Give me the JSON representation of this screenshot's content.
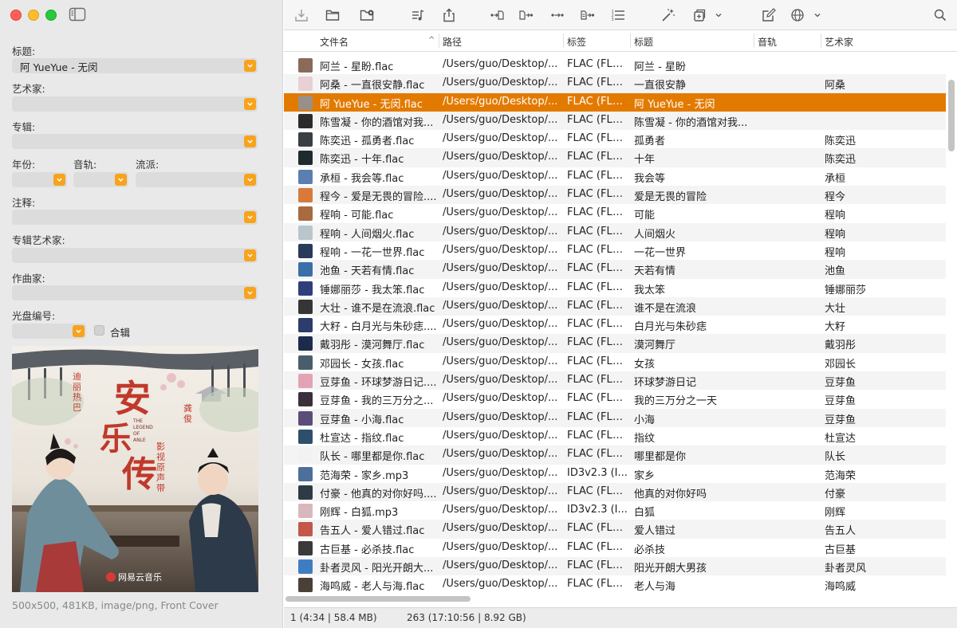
{
  "sidebar": {
    "fields": {
      "title_label": "标题:",
      "title_value": "阿 YueYue - 无闵",
      "artist_label": "艺术家:",
      "artist_value": "",
      "album_label": "专辑:",
      "album_value": "",
      "year_label": "年份:",
      "track_label": "音轨:",
      "genre_label": "流派:",
      "comment_label": "注释:",
      "album_artist_label": "专辑艺术家:",
      "composer_label": "作曲家:",
      "disc_label": "光盘编号:",
      "compilation_label": "合辑"
    },
    "cover_info": "500x500, 481KB, image/png, Front Cover",
    "cover_text": {
      "big_title": "安乐传",
      "en_title": "THE LEGEND OF ANLE",
      "left_vertical": "迪丽热巴",
      "right_vertical": "龚俊",
      "subtitle": "影视原声带",
      "brand": "网易云音乐"
    }
  },
  "toolbar": {
    "icons": [
      "tray-download-icon",
      "folder-icon",
      "folder-gear-icon",
      "music-list-icon",
      "share-icon",
      "tag-to-file-icon",
      "file-to-tag-icon",
      "tag-to-tag-icon",
      "text-file-to-tag-icon",
      "numbered-list-icon",
      "magic-wand-icon",
      "copy-icon",
      "chevron-down-icon",
      "edit-icon",
      "globe-icon",
      "chevron-down-icon",
      "search-icon"
    ]
  },
  "table": {
    "columns": [
      "文件名",
      "路径",
      "标签",
      "标题",
      "音轨",
      "艺术家"
    ],
    "rows": [
      {
        "file": "阿兰 - 星盼.flac",
        "path": "/Users/guo/Desktop/...",
        "tag": "FLAC (FLA...",
        "title": "阿兰 - 星盼",
        "artist": "",
        "thumb": "#8a6a5a"
      },
      {
        "file": "阿桑 - 一直很安静.flac",
        "path": "/Users/guo/Desktop/...",
        "tag": "FLAC (FLA...",
        "title": "一直很安静",
        "artist": "阿桑",
        "thumb": "#e8d0d6"
      },
      {
        "file": "阿 YueYue - 无闵.flac",
        "path": "/Users/guo/Desktop/...",
        "tag": "FLAC (FLA...",
        "title": "阿 YueYue - 无闵",
        "artist": "",
        "thumb": "#9a8f86"
      },
      {
        "file": "陈雪凝 - 你的酒馆对我...",
        "path": "/Users/guo/Desktop/...",
        "tag": "FLAC (FLA...",
        "title": "陈雪凝 - 你的酒馆对我...",
        "artist": "",
        "thumb": "#2d2a2a"
      },
      {
        "file": "陈奕迅 - 孤勇者.flac",
        "path": "/Users/guo/Desktop/...",
        "tag": "FLAC (FLA...",
        "title": "孤勇者",
        "artist": "陈奕迅",
        "thumb": "#3a3f44"
      },
      {
        "file": "陈奕迅 - 十年.flac",
        "path": "/Users/guo/Desktop/...",
        "tag": "FLAC (FLA...",
        "title": "十年",
        "artist": "陈奕迅",
        "thumb": "#1f2a2f"
      },
      {
        "file": "承桓 - 我会等.flac",
        "path": "/Users/guo/Desktop/...",
        "tag": "FLAC (FLA...",
        "title": "我会等",
        "artist": "承桓",
        "thumb": "#5b7fb0"
      },
      {
        "file": "程今 - 爱是无畏的冒险....",
        "path": "/Users/guo/Desktop/...",
        "tag": "FLAC (FLA...",
        "title": "爱是无畏的冒险",
        "artist": "程今",
        "thumb": "#d87a3a"
      },
      {
        "file": "程响 - 可能.flac",
        "path": "/Users/guo/Desktop/...",
        "tag": "FLAC (FLA...",
        "title": "可能",
        "artist": "程响",
        "thumb": "#a86a3e"
      },
      {
        "file": "程响 - 人间烟火.flac",
        "path": "/Users/guo/Desktop/...",
        "tag": "FLAC (FLA...",
        "title": "人间烟火",
        "artist": "程响",
        "thumb": "#b9c6cc"
      },
      {
        "file": "程响 - 一花一世界.flac",
        "path": "/Users/guo/Desktop/...",
        "tag": "FLAC (FLA...",
        "title": "一花一世界",
        "artist": "程响",
        "thumb": "#2a3a5a"
      },
      {
        "file": "池鱼 - 天若有情.flac",
        "path": "/Users/guo/Desktop/...",
        "tag": "FLAC (FLA...",
        "title": "天若有情",
        "artist": "池鱼",
        "thumb": "#3b6fa8"
      },
      {
        "file": "锤娜丽莎 - 我太笨.flac",
        "path": "/Users/guo/Desktop/...",
        "tag": "FLAC (FLA...",
        "title": "我太笨",
        "artist": "锤娜丽莎",
        "thumb": "#2f3e7a"
      },
      {
        "file": "大壮 - 谁不是在流浪.flac",
        "path": "/Users/guo/Desktop/...",
        "tag": "FLAC (FLA...",
        "title": "谁不是在流浪",
        "artist": "大壮",
        "thumb": "#353535"
      },
      {
        "file": "大籽 - 白月光与朱砂痣....",
        "path": "/Users/guo/Desktop/...",
        "tag": "FLAC (FLA...",
        "title": "白月光与朱砂痣",
        "artist": "大籽",
        "thumb": "#2c3c6c"
      },
      {
        "file": "戴羽彤 - 漠河舞厅.flac",
        "path": "/Users/guo/Desktop/...",
        "tag": "FLAC (FLA...",
        "title": "漠河舞厅",
        "artist": "戴羽彤",
        "thumb": "#1d2b4a"
      },
      {
        "file": "邓园长 - 女孩.flac",
        "path": "/Users/guo/Desktop/...",
        "tag": "FLAC (FLA...",
        "title": "女孩",
        "artist": "邓园长",
        "thumb": "#4a5d6b"
      },
      {
        "file": "豆芽鱼 - 环球梦游日记....",
        "path": "/Users/guo/Desktop/...",
        "tag": "FLAC (FLA...",
        "title": "环球梦游日记",
        "artist": "豆芽鱼",
        "thumb": "#e3a3b6"
      },
      {
        "file": "豆芽鱼 - 我的三万分之...",
        "path": "/Users/guo/Desktop/...",
        "tag": "FLAC (FLA...",
        "title": "我的三万分之一天",
        "artist": "豆芽鱼",
        "thumb": "#3a2f3a"
      },
      {
        "file": "豆芽鱼 - 小海.flac",
        "path": "/Users/guo/Desktop/...",
        "tag": "FLAC (FLA...",
        "title": "小海",
        "artist": "豆芽鱼",
        "thumb": "#5a4d7a"
      },
      {
        "file": "杜宣达 - 指纹.flac",
        "path": "/Users/guo/Desktop/...",
        "tag": "FLAC (FLA...",
        "title": "指纹",
        "artist": "杜宣达",
        "thumb": "#2d4f6c"
      },
      {
        "file": "队长 - 哪里都是你.flac",
        "path": "/Users/guo/Desktop/...",
        "tag": "FLAC (FLA...",
        "title": "哪里都是你",
        "artist": "队长",
        "thumb": "#f2f2f2"
      },
      {
        "file": "范海荣 - 家乡.mp3",
        "path": "/Users/guo/Desktop/...",
        "tag": "ID3v2.3 (I...",
        "title": "家乡",
        "artist": "范海荣",
        "thumb": "#4e6f9a"
      },
      {
        "file": "付豪 - 他真的对你好吗....",
        "path": "/Users/guo/Desktop/...",
        "tag": "FLAC (FLA...",
        "title": "他真的对你好吗",
        "artist": "付豪",
        "thumb": "#2e3b45"
      },
      {
        "file": "刚辉 - 白狐.mp3",
        "path": "/Users/guo/Desktop/...",
        "tag": "ID3v2.3 (I...",
        "title": "白狐",
        "artist": "刚辉",
        "thumb": "#d9b7bf"
      },
      {
        "file": "告五人 - 爱人错过.flac",
        "path": "/Users/guo/Desktop/...",
        "tag": "FLAC (FLA...",
        "title": "爱人错过",
        "artist": "告五人",
        "thumb": "#c2574a"
      },
      {
        "file": "古巨基 - 必杀技.flac",
        "path": "/Users/guo/Desktop/...",
        "tag": "FLAC (FLA...",
        "title": "必杀技",
        "artist": "古巨基",
        "thumb": "#3a3a3a"
      },
      {
        "file": "卦者灵风 - 阳光开朗大...",
        "path": "/Users/guo/Desktop/...",
        "tag": "FLAC (FLA...",
        "title": "阳光开朗大男孩",
        "artist": "卦者灵风",
        "thumb": "#3f7dc3"
      },
      {
        "file": "海鸣威 - 老人与海.flac",
        "path": "/Users/guo/Desktop/...",
        "tag": "FLAC (FLA...",
        "title": "老人与海",
        "artist": "海鸣威",
        "thumb": "#4a4036"
      }
    ],
    "selected_index": 2
  },
  "status": {
    "selection": "1 (4:34 | 58.4 MB)",
    "total": "263 (17:10:56 | 8.92 GB)"
  },
  "colors": {
    "accent": "#e37a00",
    "combo_button": "#f7a31c"
  }
}
